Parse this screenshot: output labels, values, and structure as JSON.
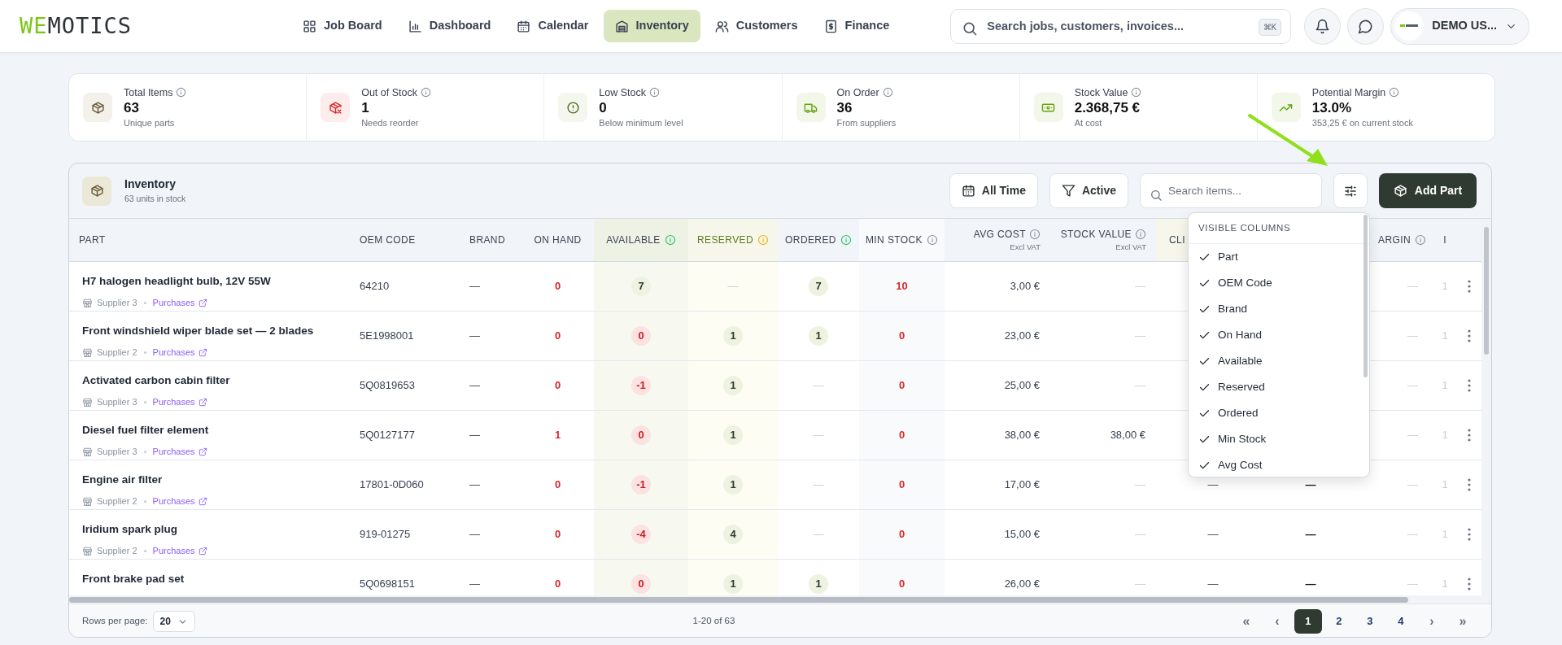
{
  "logo": {
    "accent": "WE",
    "rest": "MOTICS"
  },
  "nav": [
    {
      "label": "Job Board",
      "selected": false
    },
    {
      "label": "Dashboard",
      "selected": false
    },
    {
      "label": "Calendar",
      "selected": false
    },
    {
      "label": "Inventory",
      "selected": true
    },
    {
      "label": "Customers",
      "selected": false
    },
    {
      "label": "Finance",
      "selected": false
    }
  ],
  "search": {
    "placeholder": "Search jobs, customers, invoices...",
    "shortcut": "⌘K"
  },
  "user": {
    "name": "DEMO US..."
  },
  "stats": [
    {
      "title": "Total Items",
      "value": "63",
      "sub": "Unique parts"
    },
    {
      "title": "Out of Stock",
      "value": "1",
      "sub": "Needs reorder"
    },
    {
      "title": "Low Stock",
      "value": "0",
      "sub": "Below minimum level"
    },
    {
      "title": "On Order",
      "value": "36",
      "sub": "From suppliers"
    },
    {
      "title": "Stock Value",
      "value": "2.368,75 €",
      "sub": "At cost"
    },
    {
      "title": "Potential Margin",
      "value": "13.0%",
      "sub": "353,25 € on current stock"
    }
  ],
  "inventory": {
    "title": "Inventory",
    "subtitle": "63 units in stock",
    "filters": [
      {
        "label": "All Time"
      },
      {
        "label": "Active"
      }
    ],
    "search": {
      "placeholder": "Search items..."
    },
    "add_button": "Add Part",
    "columns": [
      {
        "label": "PART"
      },
      {
        "label": "OEM CODE"
      },
      {
        "label": "BRAND"
      },
      {
        "label": "ON HAND"
      },
      {
        "label": "AVAILABLE"
      },
      {
        "label": "RESERVED"
      },
      {
        "label": "ORDERED"
      },
      {
        "label": "MIN STOCK"
      },
      {
        "label": "AVG COST",
        "note": "Excl VAT"
      },
      {
        "label": "STOCK VALUE",
        "note": "Excl VAT"
      },
      {
        "label": "CLI"
      },
      {},
      {
        "label": "ARGIN"
      },
      {
        "label": "I"
      }
    ],
    "rows": [
      {
        "cells": [
          {
            "text": "H7 halogen headlight bulb, 12V 55W",
            "kind": "part",
            "supplier": "Supplier 3",
            "link": "Purchases"
          },
          {
            "text": "64210",
            "kind": "plain"
          },
          {
            "text": "—",
            "kind": "plain"
          },
          {
            "text": "0",
            "kind": "alert"
          },
          {
            "text": "7",
            "kind": "badge-ok"
          },
          {
            "text": "—",
            "kind": "faint"
          },
          {
            "text": "7",
            "kind": "badge-ok"
          },
          {
            "text": "10",
            "kind": "alert"
          },
          {
            "text": "3,00 €",
            "kind": "plain"
          },
          {
            "text": "—",
            "kind": "faint"
          },
          null,
          null,
          {
            "text": "—",
            "kind": "faint"
          },
          {
            "text": "1",
            "kind": "faint"
          }
        ]
      },
      {
        "cells": [
          {
            "text": "Front windshield wiper blade set — 2 blades",
            "kind": "part",
            "supplier": "Supplier 2",
            "link": "Purchases"
          },
          {
            "text": "5E1998001",
            "kind": "plain"
          },
          {
            "text": "—",
            "kind": "plain"
          },
          {
            "text": "0",
            "kind": "alert"
          },
          {
            "text": "0",
            "kind": "badge-low"
          },
          {
            "text": "1",
            "kind": "badge-ok"
          },
          {
            "text": "1",
            "kind": "badge-ok"
          },
          {
            "text": "0",
            "kind": "alert"
          },
          {
            "text": "23,00 €",
            "kind": "plain"
          },
          {
            "text": "—",
            "kind": "faint"
          },
          null,
          null,
          {
            "text": "—",
            "kind": "faint"
          },
          {
            "text": "1",
            "kind": "faint"
          }
        ]
      },
      {
        "cells": [
          {
            "text": "Activated carbon cabin filter",
            "kind": "part",
            "supplier": "Supplier 3",
            "link": "Purchases"
          },
          {
            "text": "5Q0819653",
            "kind": "plain"
          },
          {
            "text": "—",
            "kind": "plain"
          },
          {
            "text": "0",
            "kind": "alert"
          },
          {
            "text": "-1",
            "kind": "badge-low"
          },
          {
            "text": "1",
            "kind": "badge-ok"
          },
          {
            "text": "—",
            "kind": "faint"
          },
          {
            "text": "0",
            "kind": "alert"
          },
          {
            "text": "25,00 €",
            "kind": "plain"
          },
          {
            "text": "—",
            "kind": "faint"
          },
          null,
          null,
          {
            "text": "—",
            "kind": "faint"
          },
          {
            "text": "1",
            "kind": "faint"
          }
        ]
      },
      {
        "cells": [
          {
            "text": "Diesel fuel filter element",
            "kind": "part",
            "supplier": "Supplier 3",
            "link": "Purchases"
          },
          {
            "text": "5Q0127177",
            "kind": "plain"
          },
          {
            "text": "—",
            "kind": "plain"
          },
          {
            "text": "1",
            "kind": "alert"
          },
          {
            "text": "0",
            "kind": "badge-low"
          },
          {
            "text": "1",
            "kind": "badge-ok"
          },
          {
            "text": "—",
            "kind": "faint"
          },
          {
            "text": "0",
            "kind": "alert"
          },
          {
            "text": "38,00 €",
            "kind": "plain"
          },
          {
            "text": "38,00 €",
            "kind": "plain"
          },
          null,
          null,
          {
            "text": "—",
            "kind": "faint"
          },
          {
            "text": "1",
            "kind": "faint"
          }
        ]
      },
      {
        "cells": [
          {
            "text": "Engine air filter",
            "kind": "part",
            "supplier": "Supplier 2",
            "link": "Purchases"
          },
          {
            "text": "17801-0D060",
            "kind": "plain"
          },
          {
            "text": "—",
            "kind": "plain"
          },
          {
            "text": "0",
            "kind": "alert"
          },
          {
            "text": "-1",
            "kind": "badge-low"
          },
          {
            "text": "1",
            "kind": "badge-ok"
          },
          {
            "text": "—",
            "kind": "faint"
          },
          {
            "text": "0",
            "kind": "alert"
          },
          {
            "text": "17,00 €",
            "kind": "plain"
          },
          {
            "text": "—",
            "kind": "faint"
          },
          {
            "text": "—",
            "kind": "plain"
          },
          {
            "text": "—",
            "kind": "strong"
          },
          {
            "text": "—",
            "kind": "faint"
          },
          {
            "text": "1",
            "kind": "faint"
          }
        ]
      },
      {
        "cells": [
          {
            "text": "Iridium spark plug",
            "kind": "part",
            "supplier": "Supplier 2",
            "link": "Purchases"
          },
          {
            "text": "919-01275",
            "kind": "plain"
          },
          {
            "text": "—",
            "kind": "plain"
          },
          {
            "text": "0",
            "kind": "alert"
          },
          {
            "text": "-4",
            "kind": "badge-low"
          },
          {
            "text": "4",
            "kind": "badge-ok"
          },
          {
            "text": "—",
            "kind": "faint"
          },
          {
            "text": "0",
            "kind": "alert"
          },
          {
            "text": "15,00 €",
            "kind": "plain"
          },
          {
            "text": "—",
            "kind": "faint"
          },
          {
            "text": "—",
            "kind": "plain"
          },
          {
            "text": "—",
            "kind": "strong"
          },
          {
            "text": "—",
            "kind": "faint"
          },
          {
            "text": "1",
            "kind": "faint"
          }
        ]
      },
      {
        "cells": [
          {
            "text": "Front brake pad set",
            "kind": "part"
          },
          {
            "text": "5Q0698151",
            "kind": "plain"
          },
          {
            "text": "—",
            "kind": "plain"
          },
          {
            "text": "0",
            "kind": "alert"
          },
          {
            "text": "0",
            "kind": "badge-low"
          },
          {
            "text": "1",
            "kind": "badge-ok"
          },
          {
            "text": "1",
            "kind": "badge-ok"
          },
          {
            "text": "0",
            "kind": "alert"
          },
          {
            "text": "26,00 €",
            "kind": "plain"
          },
          {
            "text": "—",
            "kind": "faint"
          },
          {
            "text": "—",
            "kind": "plain"
          },
          {
            "text": "—",
            "kind": "strong"
          },
          {
            "text": "—",
            "kind": "faint"
          },
          {
            "text": "1",
            "kind": "faint"
          }
        ]
      }
    ],
    "column_menu": {
      "title": "VISIBLE COLUMNS",
      "items": [
        {
          "label": "Part",
          "checked": true
        },
        {
          "label": "OEM Code",
          "checked": true
        },
        {
          "label": "Brand",
          "checked": true
        },
        {
          "label": "On Hand",
          "checked": true
        },
        {
          "label": "Available",
          "checked": true
        },
        {
          "label": "Reserved",
          "checked": true
        },
        {
          "label": "Ordered",
          "checked": true
        },
        {
          "label": "Min Stock",
          "checked": true
        },
        {
          "label": "Avg Cost",
          "checked": true
        }
      ]
    },
    "footer": {
      "rows_label": "Rows per page:",
      "rows_value": "20",
      "range": "1-20 of 63",
      "pages": [
        {
          "label": "«",
          "kind": "arrow",
          "selected": false
        },
        {
          "label": "‹",
          "kind": "arrow",
          "selected": false
        },
        {
          "label": "1",
          "kind": "page",
          "selected": true
        },
        {
          "label": "2",
          "kind": "page",
          "selected": false
        },
        {
          "label": "3",
          "kind": "page",
          "selected": false
        },
        {
          "label": "4",
          "kind": "page",
          "selected": false
        },
        {
          "label": "›",
          "kind": "arrow",
          "selected": false
        },
        {
          "label": "»",
          "kind": "arrow",
          "selected": false
        }
      ]
    }
  }
}
